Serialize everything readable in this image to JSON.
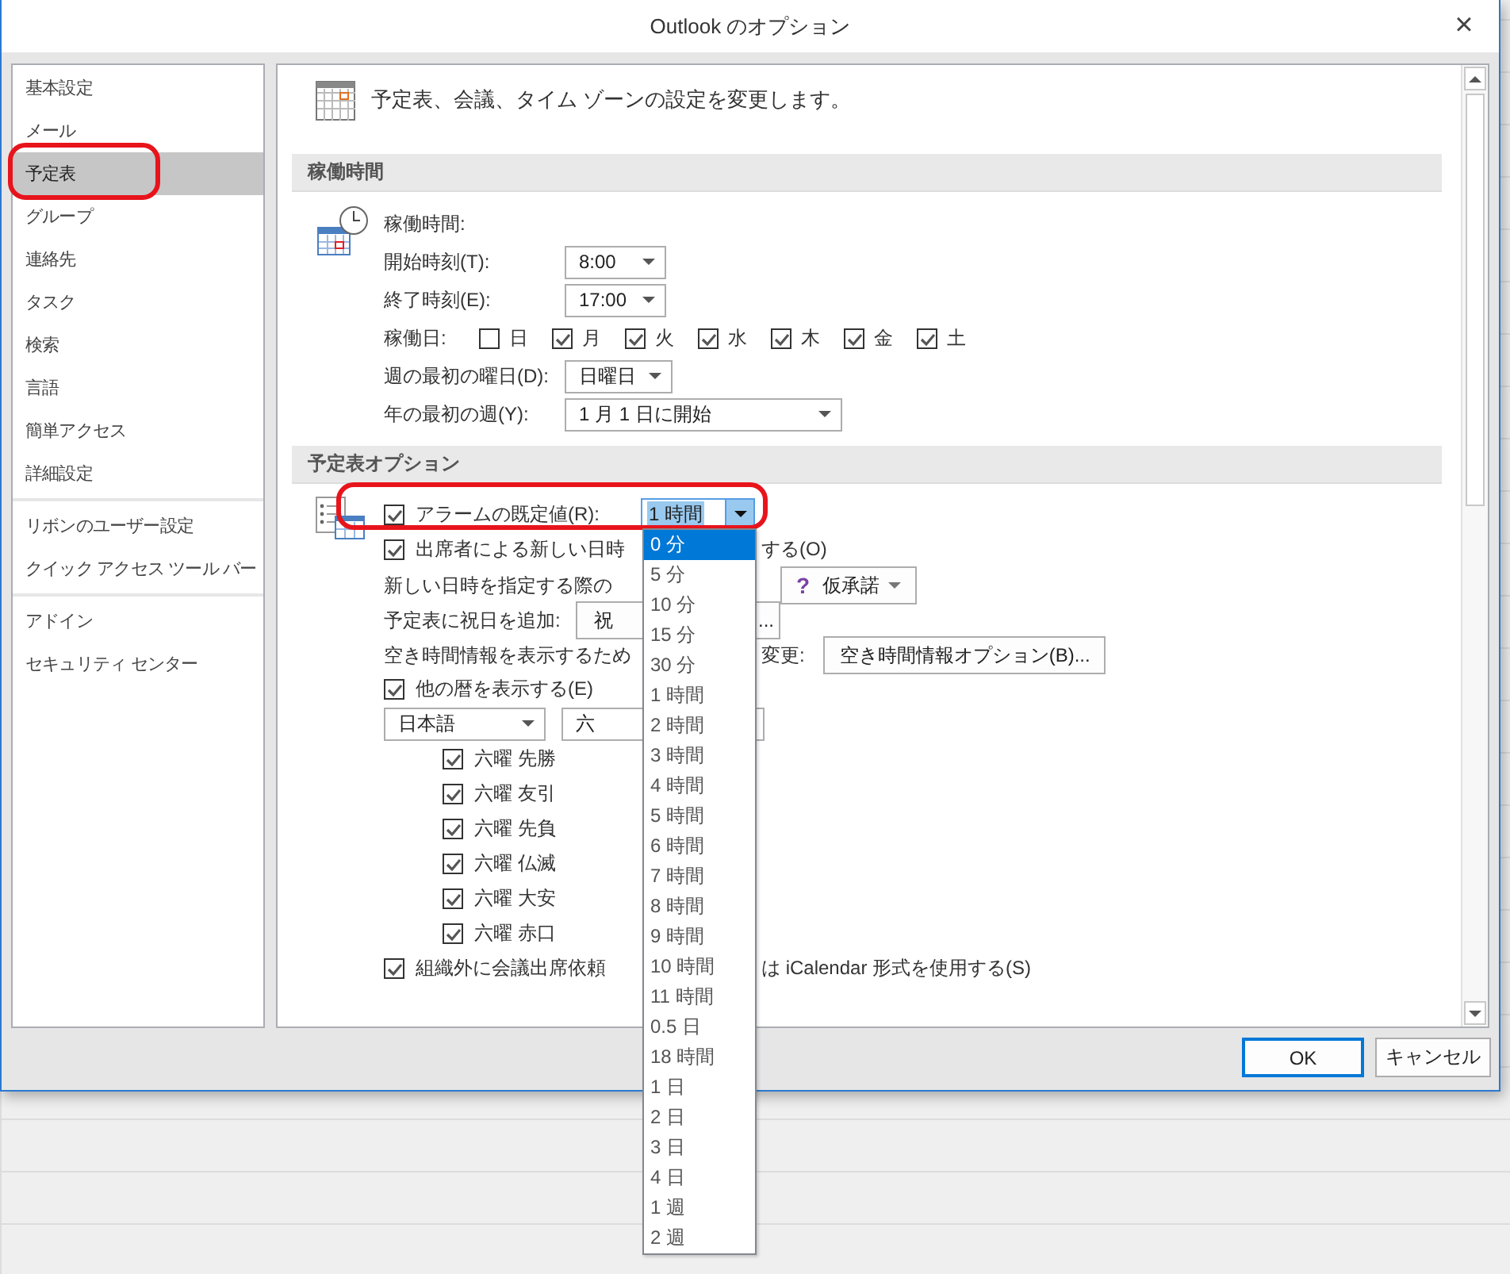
{
  "window": {
    "title": "Outlook のオプション",
    "close": "×"
  },
  "nav": {
    "groups": [
      {
        "items": [
          {
            "label": "基本設定",
            "selected": false,
            "highlighted": false
          },
          {
            "label": "メール",
            "selected": false,
            "highlighted": false
          },
          {
            "label": "予定表",
            "selected": true,
            "highlighted": true
          },
          {
            "label": "グループ",
            "selected": false,
            "highlighted": false
          },
          {
            "label": "連絡先",
            "selected": false,
            "highlighted": false
          },
          {
            "label": "タスク",
            "selected": false,
            "highlighted": false
          },
          {
            "label": "検索",
            "selected": false,
            "highlighted": false
          },
          {
            "label": "言語",
            "selected": false,
            "highlighted": false
          },
          {
            "label": "簡単アクセス",
            "selected": false,
            "highlighted": false
          },
          {
            "label": "詳細設定",
            "selected": false,
            "highlighted": false
          }
        ]
      },
      {
        "items": [
          {
            "label": "リボンのユーザー設定",
            "selected": false,
            "highlighted": false
          },
          {
            "label": "クイック アクセス ツール バー",
            "selected": false,
            "highlighted": false
          }
        ]
      },
      {
        "items": [
          {
            "label": "アドイン",
            "selected": false,
            "highlighted": false
          },
          {
            "label": "セキュリティ センター",
            "selected": false,
            "highlighted": false
          }
        ]
      }
    ]
  },
  "header": "予定表、会議、タイム ゾーンの設定を変更します。",
  "work_hours": {
    "title": "稼働時間",
    "heading": "稼働時間:",
    "start": {
      "label": "開始時刻(T):",
      "value": "8:00"
    },
    "end": {
      "label": "終了時刻(E):",
      "value": "17:00"
    },
    "workdays": {
      "label": "稼働日:",
      "days": [
        {
          "label": "日",
          "checked": false
        },
        {
          "label": "月",
          "checked": true
        },
        {
          "label": "火",
          "checked": true
        },
        {
          "label": "水",
          "checked": true
        },
        {
          "label": "木",
          "checked": true
        },
        {
          "label": "金",
          "checked": true
        },
        {
          "label": "土",
          "checked": true
        }
      ]
    },
    "first_day": {
      "label": "週の最初の曜日(D):",
      "value": "日曜日"
    },
    "first_week": {
      "label": "年の最初の週(Y):",
      "value": "1 月 1 日に開始"
    }
  },
  "calendar_options": {
    "title": "予定表オプション",
    "rows": [
      {
        "kind": "alarm",
        "checked": true,
        "label": "アラームの既定値(R):",
        "value": "1 時間",
        "expanded": true,
        "highlighted": true
      },
      {
        "kind": "check-split",
        "checked": true,
        "label": "出席者による新しい日時",
        "label_after": "する(O)"
      },
      {
        "kind": "text-button",
        "label": "新しい日時を指定する際の",
        "button_icon": "?",
        "button": "仮承諾"
      },
      {
        "kind": "split-button",
        "label": "予定表に祝日を追加:",
        "button_parts": [
          "祝",
          "..."
        ]
      },
      {
        "kind": "text-split-button",
        "label": "空き時間情報を表示するため",
        "label_after": "変更:",
        "button": "空き時間情報オプション(B)..."
      },
      {
        "kind": "check",
        "checked": true,
        "label": "他の暦を表示する(E)"
      },
      {
        "kind": "selects",
        "selects": [
          "日本語",
          "六"
        ]
      },
      {
        "kind": "subcheck",
        "checked": true,
        "label": "六曜 先勝"
      },
      {
        "kind": "subcheck",
        "checked": true,
        "label": "六曜 友引"
      },
      {
        "kind": "subcheck",
        "checked": true,
        "label": "六曜 先負"
      },
      {
        "kind": "subcheck",
        "checked": true,
        "label": "六曜 仏滅"
      },
      {
        "kind": "subcheck",
        "checked": true,
        "label": "六曜 大安"
      },
      {
        "kind": "subcheck",
        "checked": true,
        "label": "六曜 赤口"
      },
      {
        "kind": "check-split",
        "checked": true,
        "label": "組織外に会議出席依頼",
        "label_after": "は iCalendar 形式を使用する(S)"
      }
    ]
  },
  "alarm_dropdown": {
    "items": [
      {
        "label": "0 分",
        "selected": true
      },
      {
        "label": "5 分",
        "selected": false
      },
      {
        "label": "10 分",
        "selected": false
      },
      {
        "label": "15 分",
        "selected": false
      },
      {
        "label": "30 分",
        "selected": false
      },
      {
        "label": "1 時間",
        "selected": false
      },
      {
        "label": "2 時間",
        "selected": false
      },
      {
        "label": "3 時間",
        "selected": false
      },
      {
        "label": "4 時間",
        "selected": false
      },
      {
        "label": "5 時間",
        "selected": false
      },
      {
        "label": "6 時間",
        "selected": false
      },
      {
        "label": "7 時間",
        "selected": false
      },
      {
        "label": "8 時間",
        "selected": false
      },
      {
        "label": "9 時間",
        "selected": false
      },
      {
        "label": "10 時間",
        "selected": false
      },
      {
        "label": "11 時間",
        "selected": false
      },
      {
        "label": "0.5 日",
        "selected": false
      },
      {
        "label": "18 時間",
        "selected": false
      },
      {
        "label": "1 日",
        "selected": false
      },
      {
        "label": "2 日",
        "selected": false
      },
      {
        "label": "3 日",
        "selected": false
      },
      {
        "label": "4 日",
        "selected": false
      },
      {
        "label": "1 週",
        "selected": false
      },
      {
        "label": "2 週",
        "selected": false
      }
    ]
  },
  "buttons": [
    {
      "label": "OK",
      "kind": "default"
    },
    {
      "label": "キャンセル",
      "kind": "normal"
    }
  ]
}
